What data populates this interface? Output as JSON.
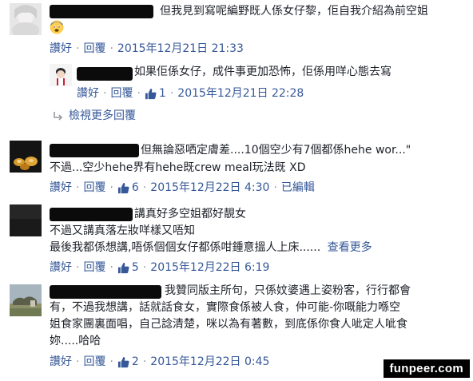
{
  "comments": [
    {
      "text_lines": [
        "但我見到寫呢編野既人係女仔黎，佢自我介紹為前空姐"
      ],
      "emoji": "fearful-face-emoji",
      "actions": {
        "like": "讚好",
        "reply": "回覆",
        "time": "2015年12月21日 21:33"
      }
    },
    {
      "text_lines": [
        "如果佢係女仔，成件事更加恐怖，佢係用咩心態去寫"
      ],
      "actions": {
        "like": "讚好",
        "reply": "回覆",
        "likes": "1",
        "time": "2015年12月21日 22:28"
      }
    },
    {
      "text_lines": [
        "但無論惡哂定膚差....10個空少有7個都係hehe wor...\"",
        "不過...空少hehe界有hehe既crew meal玩法既 XD"
      ],
      "actions": {
        "like": "讚好",
        "reply": "回覆",
        "likes": "6",
        "time": "2015年12月22日 4:30",
        "edited": "已編輯"
      }
    },
    {
      "text_lines": [
        "講真好多空姐都好靚女",
        "不過又講真落左妝咩樣又唔知",
        "最後我都係想講,唔係個個女仔都係咁鍾意搵人上床......"
      ],
      "see_more": "查看更多",
      "actions": {
        "like": "讚好",
        "reply": "回覆",
        "likes": "5",
        "time": "2015年12月22日 6:19"
      }
    },
    {
      "text_lines": [
        "我贊同版主所句，只係妏婆遇上姿粉客，行行都會",
        "有，不過我想講，話就話食女，實際食係被人食，仲可能-你嘅能力喺空",
        "姐食家團裏面唱，自己諗清楚，咪以為有著數，到底係你食人呲定人呲食",
        "妳.....哈哈"
      ],
      "actions": {
        "like": "讚好",
        "reply": "回覆",
        "likes": "2",
        "time": "2015年12月22日 0:45"
      }
    }
  ],
  "view_more_replies": "檢視更多回覆",
  "watermark": "funpeer.com",
  "colors": {
    "link": "#365899",
    "meta": "#7f7f7f",
    "text": "#1d2129"
  }
}
